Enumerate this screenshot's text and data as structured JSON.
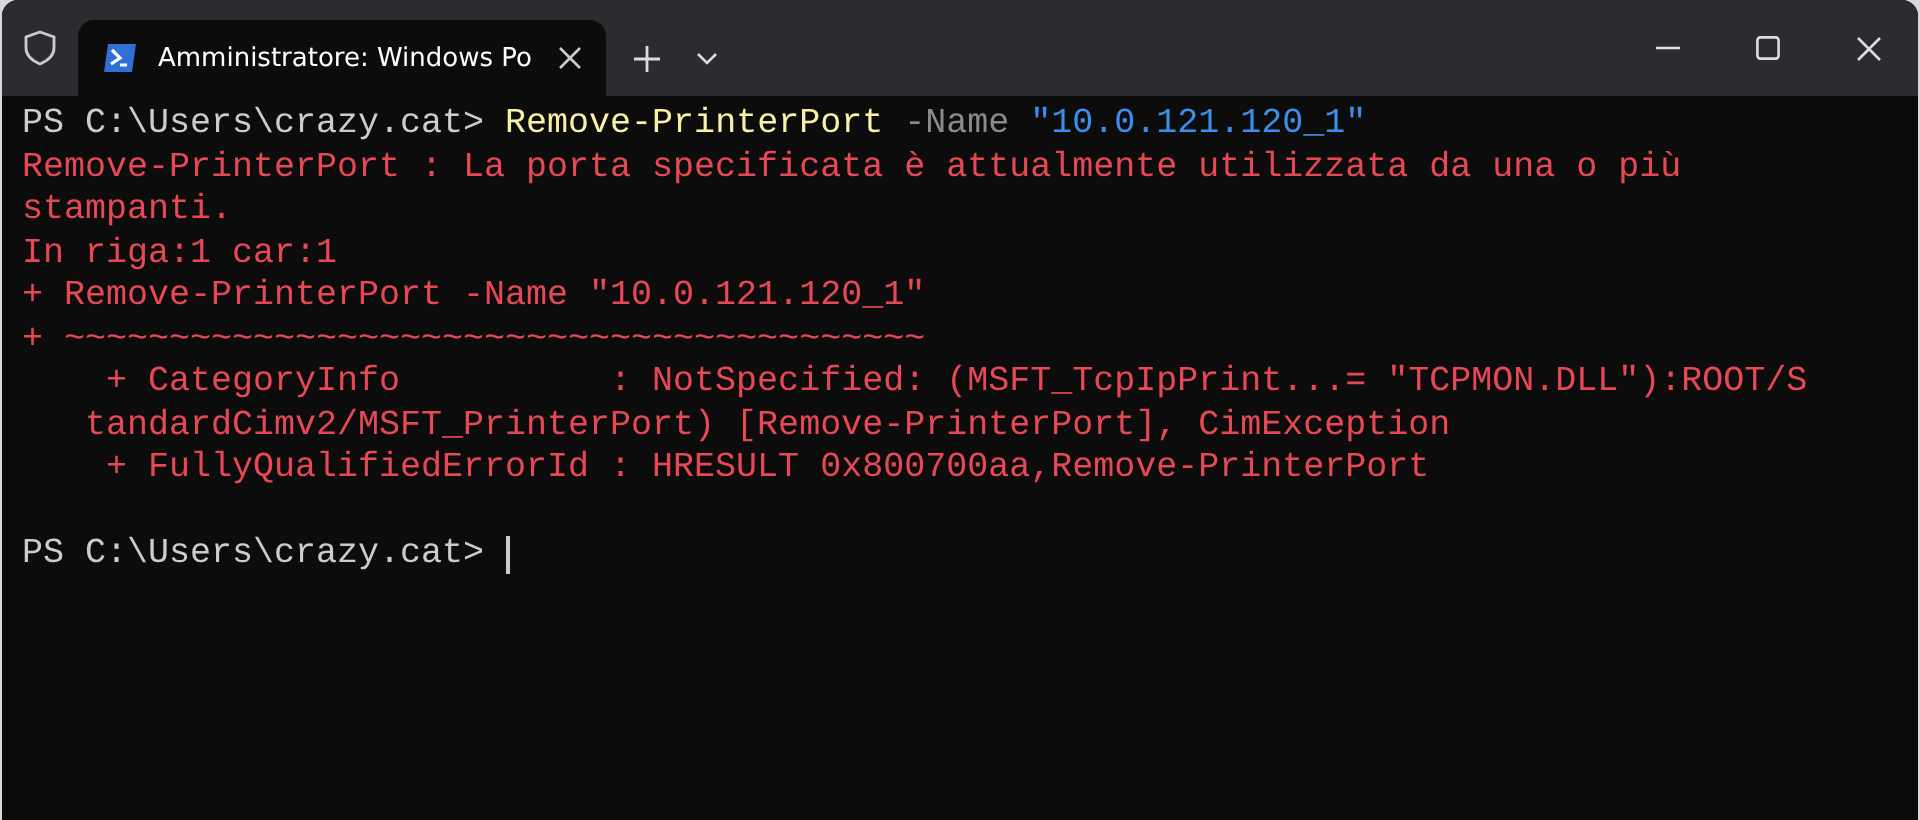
{
  "window": {
    "tab_title": "Amministratore: Windows Po"
  },
  "terminal": {
    "lines": [
      {
        "segments": [
          {
            "kind": "prompt",
            "text": "PS C:\\Users\\crazy.cat> "
          },
          {
            "kind": "command",
            "text": "Remove-PrinterPort"
          },
          {
            "kind": "param",
            "text": " -Name "
          },
          {
            "kind": "string",
            "text": "\"10.0.121.120_1\""
          }
        ]
      },
      {
        "segments": [
          {
            "kind": "error",
            "text": "Remove-PrinterPort : La porta specificata è attualmente utilizzata da una o più"
          }
        ]
      },
      {
        "segments": [
          {
            "kind": "error",
            "text": "stampanti."
          }
        ]
      },
      {
        "segments": [
          {
            "kind": "error",
            "text": "In riga:1 car:1"
          }
        ]
      },
      {
        "segments": [
          {
            "kind": "error",
            "text": "+ Remove-PrinterPort -Name \"10.0.121.120_1\""
          }
        ]
      },
      {
        "segments": [
          {
            "kind": "error",
            "text": "+ ~~~~~~~~~~~~~~~~~~~~~~~~~~~~~~~~~~~~~~~~~"
          }
        ]
      },
      {
        "segments": [
          {
            "kind": "error",
            "text": "    + CategoryInfo          : NotSpecified: (MSFT_TcpIpPrint...= \"TCPMON.DLL\"):ROOT/S"
          }
        ]
      },
      {
        "segments": [
          {
            "kind": "error",
            "text": "   tandardCimv2/MSFT_PrinterPort) [Remove-PrinterPort], CimException"
          }
        ]
      },
      {
        "segments": [
          {
            "kind": "error",
            "text": "    + FullyQualifiedErrorId : HRESULT 0x800700aa,Remove-PrinterPort"
          }
        ]
      },
      {
        "blank_before": true,
        "segments": [
          {
            "kind": "prompt",
            "text": "PS C:\\Users\\crazy.cat> "
          }
        ],
        "cursor": true
      }
    ]
  }
}
